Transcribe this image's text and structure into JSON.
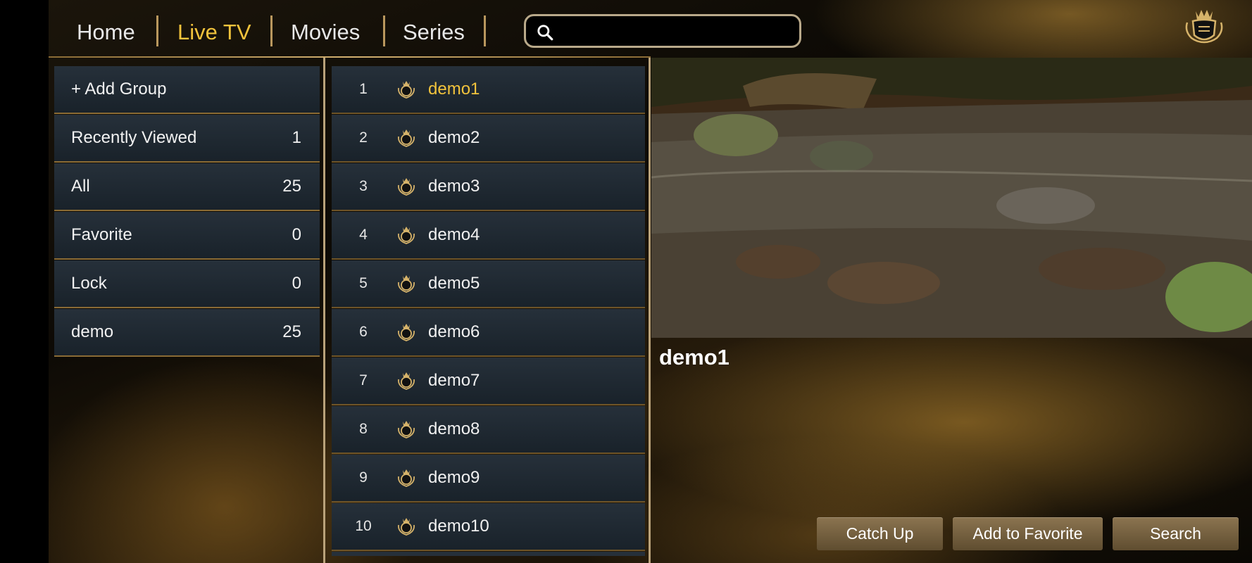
{
  "nav": {
    "tabs": [
      {
        "label": "Home"
      },
      {
        "label": "Live TV",
        "active": true
      },
      {
        "label": "Movies"
      },
      {
        "label": "Series"
      }
    ],
    "search_value": "",
    "accent_color": "#f2c33c"
  },
  "groups": [
    {
      "label": "+ Add Group",
      "count": ""
    },
    {
      "label": "Recently Viewed",
      "count": "1"
    },
    {
      "label": "All",
      "count": "25"
    },
    {
      "label": "Favorite",
      "count": "0"
    },
    {
      "label": "Lock",
      "count": "0"
    },
    {
      "label": "demo",
      "count": "25"
    }
  ],
  "channels": [
    {
      "num": "1",
      "name": "demo1",
      "selected": true
    },
    {
      "num": "2",
      "name": "demo2"
    },
    {
      "num": "3",
      "name": "demo3"
    },
    {
      "num": "4",
      "name": "demo4"
    },
    {
      "num": "5",
      "name": "demo5"
    },
    {
      "num": "6",
      "name": "demo6"
    },
    {
      "num": "7",
      "name": "demo7"
    },
    {
      "num": "8",
      "name": "demo8"
    },
    {
      "num": "9",
      "name": "demo9"
    },
    {
      "num": "10",
      "name": "demo10"
    }
  ],
  "preview": {
    "now_playing": "demo1"
  },
  "actions": {
    "catch_up": "Catch Up",
    "add_favorite": "Add to Favorite",
    "search": "Search"
  }
}
